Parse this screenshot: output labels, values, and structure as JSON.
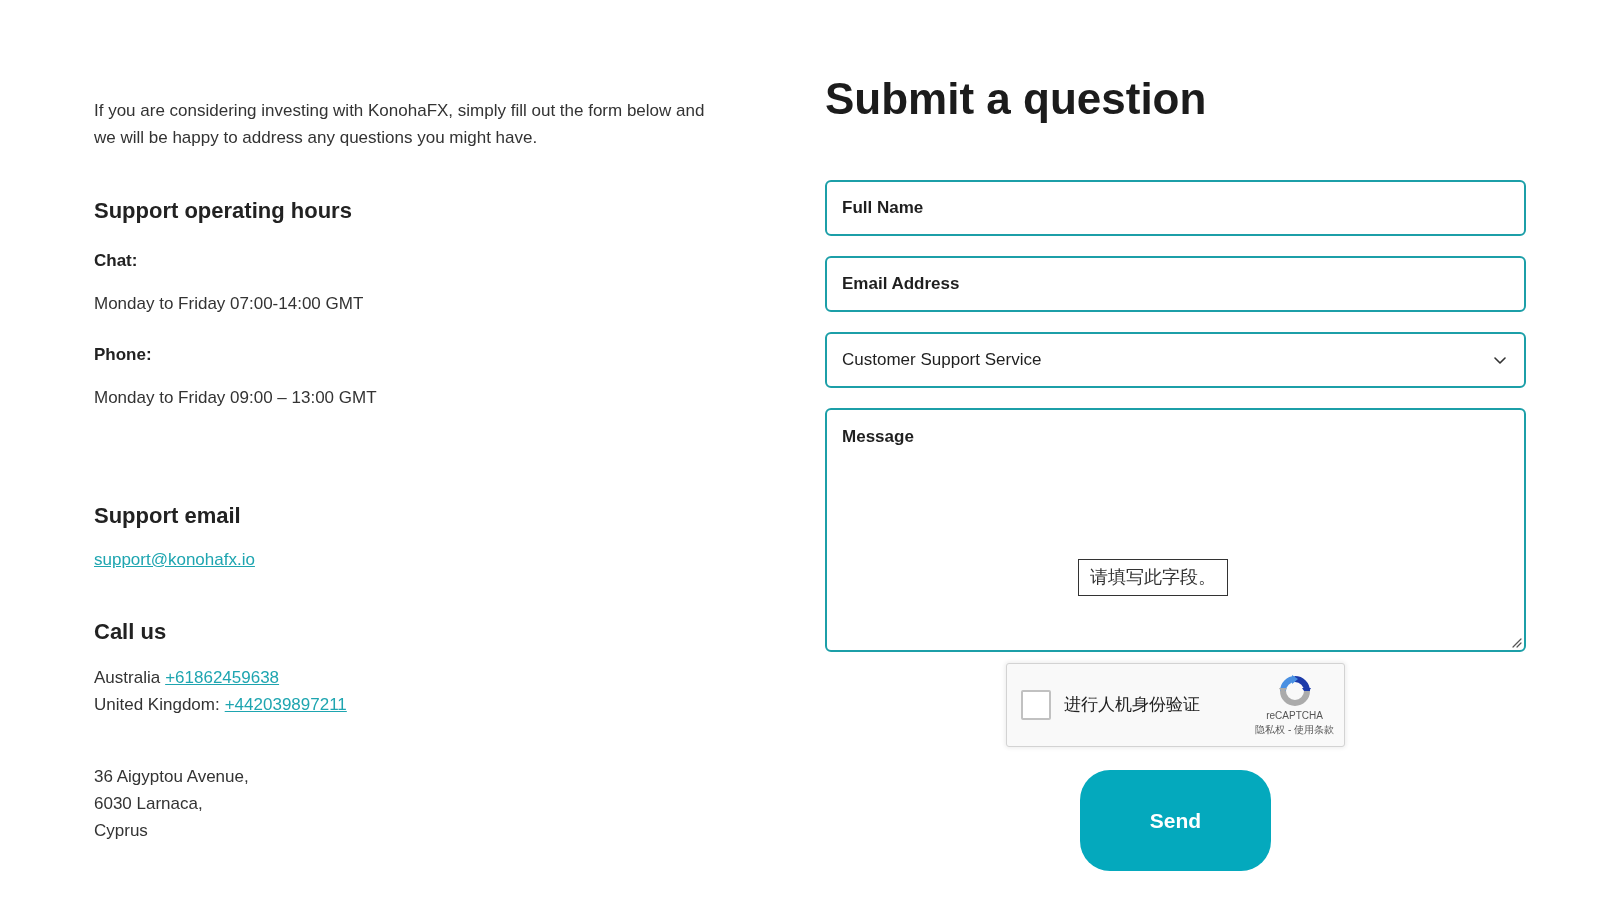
{
  "intro": "If you are considering investing with KonohaFX, simply fill out the form below and we will be happy to address any questions you might have.",
  "hours": {
    "heading": "Support operating hours",
    "entries": [
      {
        "label": "Chat:",
        "value": "Monday to Friday 07:00-14:00 GMT"
      },
      {
        "label": "Phone:",
        "value": "Monday to Friday 09:00 – 13:00 GMT"
      }
    ]
  },
  "support_email": {
    "heading": "Support email",
    "link": "support@konohafx.io"
  },
  "call_us": {
    "heading": "Call us",
    "lines": [
      {
        "label": "Australia",
        "link": "+61862459638"
      },
      {
        "label": "United Kingdom:",
        "link": "+442039897211"
      }
    ]
  },
  "address": [
    "36 Aigyptou Avenue,",
    "6030 Larnaca,",
    "Cyprus"
  ],
  "form": {
    "title": "Submit a question",
    "fields": [
      {
        "kind": "input",
        "placeholder": "Full Name"
      },
      {
        "kind": "input",
        "placeholder": "Email Address"
      },
      {
        "kind": "select",
        "value": "Customer Support Service"
      },
      {
        "kind": "textarea",
        "placeholder": "Message",
        "tooltip": "请填写此字段。"
      }
    ],
    "captcha": {
      "checked": false,
      "label": "进行人机身份验证",
      "brand": "reCAPTCHA",
      "terms": "隐私权 - 使用条款"
    },
    "submit": "Send"
  }
}
